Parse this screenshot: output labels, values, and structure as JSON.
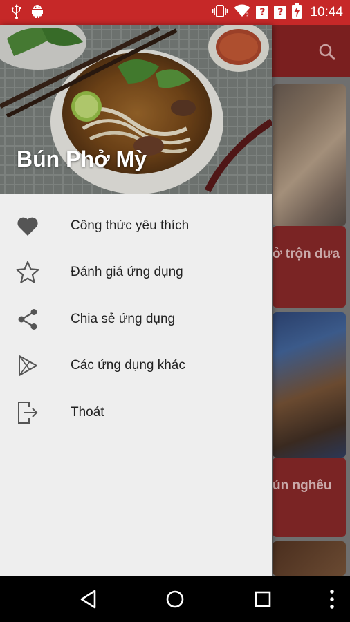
{
  "status_bar": {
    "time": "10:44",
    "left_icons": [
      "usb-icon",
      "android-icon"
    ],
    "right_icons": [
      "vibrate-icon",
      "wifi-icon",
      "sim-unknown-icon",
      "sim-unknown-icon",
      "battery-charging-icon"
    ],
    "unknown_sim_glyph": "?"
  },
  "drawer": {
    "title": "Bún Phở Mỳ",
    "items": [
      {
        "label": "Công thức yêu thích",
        "icon": "heart-icon"
      },
      {
        "label": "Đánh giá ứng dụng",
        "icon": "star-icon"
      },
      {
        "label": "Chia sẻ ứng dụng",
        "icon": "share-icon"
      },
      {
        "label": "Các ứng dụng khác",
        "icon": "play-store-icon"
      },
      {
        "label": "Thoát",
        "icon": "exit-icon"
      }
    ]
  },
  "background": {
    "cards": [
      {
        "title_fragment": "ở trộn dưa"
      },
      {
        "title_fragment": "ún nghêu"
      }
    ]
  },
  "nav_bar": {
    "buttons": [
      "back-icon",
      "home-icon",
      "recents-icon",
      "overflow-menu-icon"
    ]
  },
  "colors": {
    "status_bar": "#c62828",
    "toolbar": "#7a1f1f",
    "drawer_bg": "#eeeeee",
    "text_primary": "#222222",
    "icon": "#555555"
  }
}
